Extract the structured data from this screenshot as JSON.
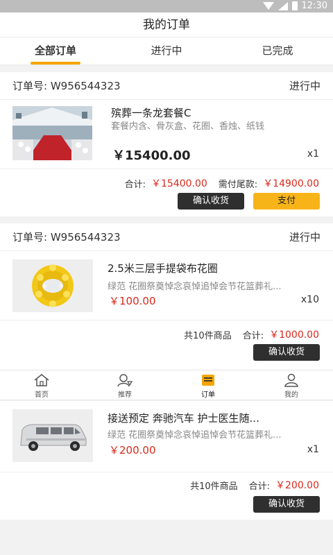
{
  "status_bar": {
    "time": "12:30"
  },
  "header": {
    "title": "我的订单"
  },
  "tabs": [
    {
      "label": "全部订单",
      "active": true
    },
    {
      "label": "进行中",
      "active": false
    },
    {
      "label": "已完成",
      "active": false
    }
  ],
  "orders": [
    {
      "order_no": "订单号: W956544323",
      "status": "进行中",
      "product": {
        "name": "殡葬一条龙套餐C",
        "desc": "套餐内含、骨灰盒、花圈、香烛、纸钱",
        "price": "￥15400.00",
        "qty": "x1"
      },
      "total_label": "合计:",
      "total": "￥15400.00",
      "balance_label": "需付尾款:",
      "balance": "￥14900.00",
      "confirm_label": "确认收货",
      "pay_label": "支付"
    },
    {
      "order_no": "订单号: W956544323",
      "status": "进行中",
      "product": {
        "name": "2.5米三层手提袋布花圈",
        "desc": "绿范 花圈祭奠悼念哀悼追悼会节花篮葬礼...",
        "price": "￥100.00",
        "qty": "x10"
      },
      "count_label": "共10件商品",
      "total_label": "合计:",
      "total": "￥1000.00",
      "confirm_label": "确认收货"
    },
    {
      "product": {
        "name": "接送预定 奔驰汽车 护士医生随...",
        "desc": "绿范 花圈祭奠悼念哀悼追悼会节花篮葬礼...",
        "price": "￥200.00",
        "qty": "x1"
      },
      "count_label": "共10件商品",
      "total_label": "合计:",
      "total": "￥200.00",
      "confirm_label": "确认收货"
    }
  ],
  "bottom_nav": [
    {
      "label": "首页",
      "icon": "home-icon"
    },
    {
      "label": "推荐",
      "icon": "recommend-icon"
    },
    {
      "label": "订单",
      "icon": "order-icon",
      "active": true
    },
    {
      "label": "我的",
      "icon": "profile-icon"
    }
  ],
  "colors": {
    "accent": "#f5a500",
    "price_red": "#d9281c",
    "pay_button": "#f7b418",
    "dark_button": "#2f2f2f"
  }
}
